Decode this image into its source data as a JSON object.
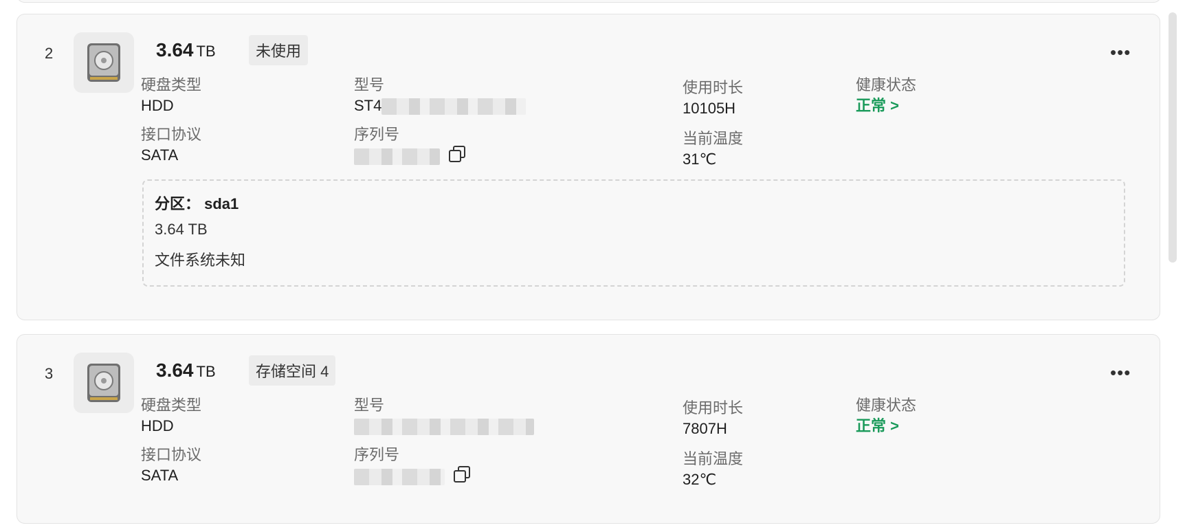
{
  "disks": [
    {
      "index": "2",
      "capacity_value": "3.64",
      "capacity_unit": "TB",
      "tag": "未使用",
      "type_label": "硬盘类型",
      "type_value": "HDD",
      "model_label": "型号",
      "model_value": "ST4",
      "hours_label": "使用时长",
      "hours_value": "10105H",
      "health_label": "健康状态",
      "health_value": "正常 >",
      "interface_label": "接口协议",
      "interface_value": "SATA",
      "serial_label": "序列号",
      "temp_label": "当前温度",
      "temp_value": "31℃",
      "partition": {
        "title": "分区： sda1",
        "size": "3.64 TB",
        "filesystem": "文件系统未知"
      }
    },
    {
      "index": "3",
      "capacity_value": "3.64",
      "capacity_unit": "TB",
      "tag": "存储空间 4",
      "type_label": "硬盘类型",
      "type_value": "HDD",
      "model_label": "型号",
      "hours_label": "使用时长",
      "hours_value": "7807H",
      "health_label": "健康状态",
      "health_value": "正常 >",
      "interface_label": "接口协议",
      "interface_value": "SATA",
      "serial_label": "序列号",
      "temp_label": "当前温度",
      "temp_value": "32℃"
    }
  ],
  "more_label": "•••",
  "colors": {
    "health_ok": "#1a9a5a",
    "card_bg": "#f8f8f8",
    "border": "#e3e3e3"
  }
}
